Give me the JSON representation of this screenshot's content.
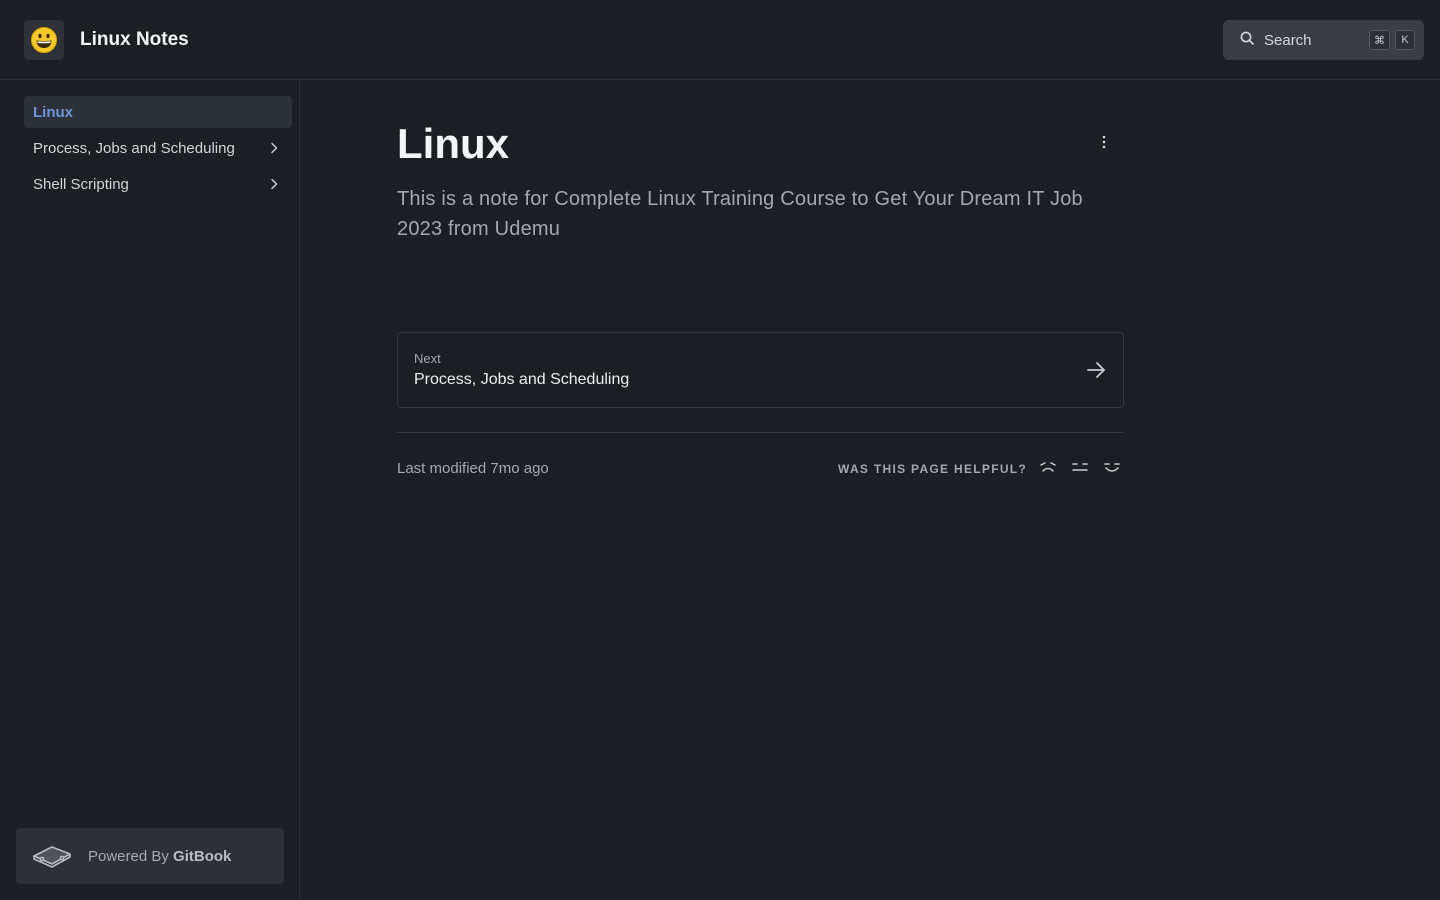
{
  "header": {
    "title": "Linux Notes",
    "logo_icon": "grinning-face-emoji",
    "search": {
      "label": "Search",
      "shortcut_cmd": "⌘",
      "shortcut_key": "K"
    }
  },
  "sidebar": {
    "items": [
      {
        "label": "Linux",
        "active": true
      },
      {
        "label": "Process, Jobs and Scheduling",
        "expandable": true
      },
      {
        "label": "Shell Scripting",
        "expandable": true
      }
    ],
    "powered": {
      "prefix": "Powered By",
      "brand": "GitBook"
    }
  },
  "main": {
    "title": "Linux",
    "description": "This is a note for Complete Linux Training Course to Get Your Dream IT Job 2023 from Udemu",
    "next": {
      "label": "Next",
      "title": "Process, Jobs and Scheduling"
    },
    "last_modified": "Last modified 7mo ago",
    "helpful": {
      "label": "WAS THIS PAGE HELPFUL?"
    }
  },
  "colors": {
    "background": "#1b1e22",
    "accent": "#6f96dc",
    "border": "#2c3035"
  }
}
